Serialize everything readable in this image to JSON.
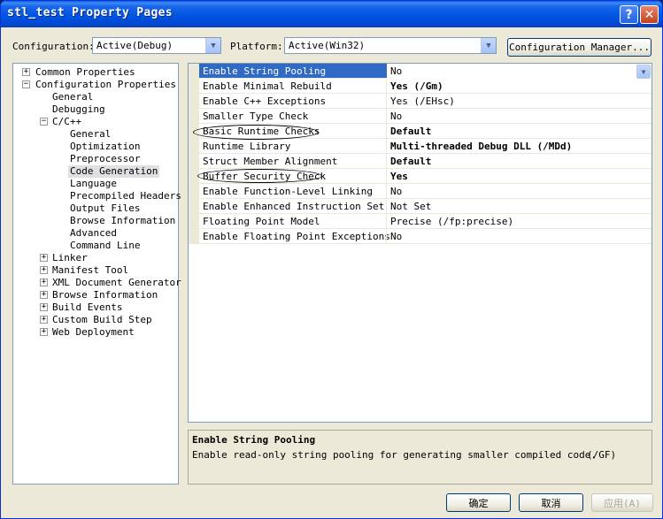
{
  "window": {
    "title": "stl_test Property Pages"
  },
  "toolbar": {
    "configuration_label": "Configuration:",
    "configuration_value": "Active(Debug)",
    "platform_label": "Platform:",
    "platform_value": "Active(Win32)",
    "config_manager_label": "Configuration Manager..."
  },
  "tree": {
    "common": "Common Properties",
    "config": "Configuration Properties",
    "general": "General",
    "debugging": "Debugging",
    "cpp": "C/C++",
    "cpp_items": [
      "General",
      "Optimization",
      "Preprocessor",
      "Code Generation",
      "Language",
      "Precompiled Headers",
      "Output Files",
      "Browse Information",
      "Advanced",
      "Command Line"
    ],
    "others": [
      "Linker",
      "Manifest Tool",
      "XML Document Generator",
      "Browse Information",
      "Build Events",
      "Custom Build Step",
      "Web Deployment"
    ]
  },
  "properties": [
    {
      "name": "Enable String Pooling",
      "value": "No"
    },
    {
      "name": "Enable Minimal Rebuild",
      "value": "Yes (/Gm)"
    },
    {
      "name": "Enable C++ Exceptions",
      "value": "Yes (/EHsc)"
    },
    {
      "name": "Smaller Type Check",
      "value": "No"
    },
    {
      "name": "Basic Runtime Checks",
      "value": "Default"
    },
    {
      "name": "Runtime Library",
      "value": "Multi-threaded Debug DLL (/MDd)"
    },
    {
      "name": "Struct Member Alignment",
      "value": "Default"
    },
    {
      "name": "Buffer Security Check",
      "value": "Yes"
    },
    {
      "name": "Enable Function-Level Linking",
      "value": "No"
    },
    {
      "name": "Enable Enhanced Instruction Set",
      "value": "Not Set"
    },
    {
      "name": "Floating Point Model",
      "value": "Precise (/fp:precise)"
    },
    {
      "name": "Enable Floating Point Exceptions",
      "value": "No"
    }
  ],
  "description": {
    "title": "Enable String Pooling",
    "text": "Enable read-only string pooling for generating smaller compiled code.",
    "switch": "(/GF)"
  },
  "buttons": {
    "ok": "确定",
    "cancel": "取消",
    "apply": "应用(A)"
  }
}
